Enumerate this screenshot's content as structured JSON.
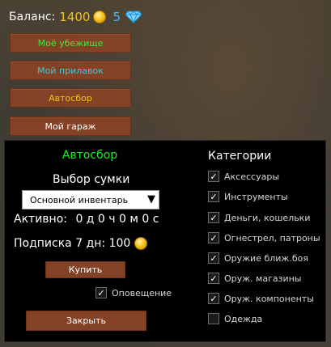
{
  "header": {
    "balance_label": "Баланс:",
    "gold_amount": "1400",
    "gem_amount": "5",
    "gold_icon": "gold-coin-icon",
    "gem_icon": "diamond-icon"
  },
  "menu": {
    "items": [
      {
        "label": "Моё убежище",
        "color": "#3fe83f"
      },
      {
        "label": "Мой прилавок",
        "color": "#3fc8d8"
      },
      {
        "label": "Автосбор",
        "color": "#f0c419"
      },
      {
        "label": "Мой гараж",
        "color": "#ffffff"
      }
    ]
  },
  "panel": {
    "title": "Автосбор",
    "bag_label": "Выбор сумки",
    "bag_selected": "Основной инвентарь",
    "active_label": "Активно:",
    "active_value": "0 д 0 ч 0 м 0 с",
    "subscription_label": "Подписка 7 дн: 100",
    "buy_label": "Купить",
    "notify_label": "Оповещение",
    "notify_checked": true,
    "close_label": "Закрыть",
    "categories_title": "Категории",
    "categories": [
      {
        "label": "Аксессуары",
        "checked": true
      },
      {
        "label": "Инструменты",
        "checked": true
      },
      {
        "label": "Деньги, кошельки",
        "checked": true
      },
      {
        "label": "Огнестрел, патроны",
        "checked": true
      },
      {
        "label": "Оружие ближ.боя",
        "checked": true
      },
      {
        "label": "Оруж. магазины",
        "checked": true
      },
      {
        "label": "Оруж. компоненты",
        "checked": true
      },
      {
        "label": "Одежда",
        "checked": false
      }
    ]
  },
  "colors": {
    "accent_green": "#22e82a",
    "button_brown": "#834226",
    "gold": "#f0c419",
    "gem_blue": "#4ab4ff"
  }
}
